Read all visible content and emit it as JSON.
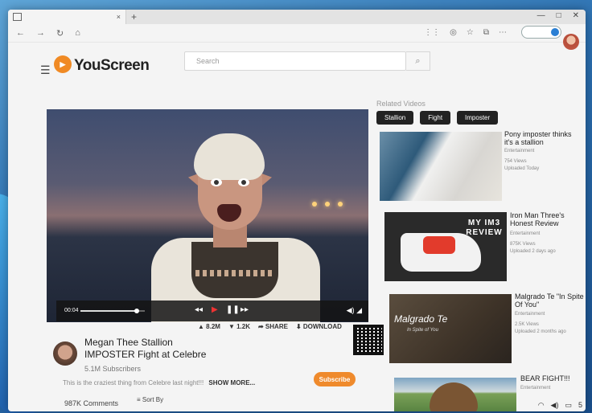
{
  "browser": {
    "tab_close": "×",
    "new_tab": "+",
    "window_controls": [
      "—",
      "□",
      "✕"
    ],
    "nav_back": "←",
    "nav_forward": "→",
    "nav_refresh": "↻",
    "nav_home": "⌂"
  },
  "site": {
    "logo_text": "YouScreen",
    "search_placeholder": "Search"
  },
  "player": {
    "time_current": "00:04",
    "progress_fraction": 0.88
  },
  "video": {
    "title": "Megan Thee Stallion IMPOSTER Fight at Celebre",
    "subscribers": "5.1M Subscribers",
    "likes": "8.2M",
    "dislikes": "1.2K",
    "share_label": "SHARE",
    "download_label": "DOWNLOAD",
    "description": "This is the craziest thing from Celebre last night!!!",
    "show_more": "SHOW MORE...",
    "subscribe_label": "Subscribe",
    "comments_count": "987K Comments",
    "sort_label": "Sort By"
  },
  "sidebar": {
    "heading": "Related Videos",
    "chips": [
      "Stallion",
      "Fight",
      "Imposter"
    ],
    "items": [
      {
        "title": "Pony imposter thinks it's a stallion",
        "category": "Entertainment",
        "views": "754 Views",
        "uploaded": "Uploaded Today"
      },
      {
        "title": "Iron Man Three's Honest Review",
        "category": "Entertainment",
        "views": "875K Views",
        "uploaded": "Uploaded 2 days ago",
        "thumb_text": "MY IM3 REVIEW"
      },
      {
        "title": "Malgrado Te \"In Spite Of You\"",
        "category": "Entertainment",
        "views": "2.5K Views",
        "uploaded": "Uploaded 2 months ago",
        "thumb_text": "Malgrado Te",
        "thumb_subtext": "In Spite of You"
      },
      {
        "title": "BEAR FIGHT!!!",
        "category": "Entertainment"
      }
    ]
  },
  "taskbar": {
    "tray_text": "5"
  }
}
